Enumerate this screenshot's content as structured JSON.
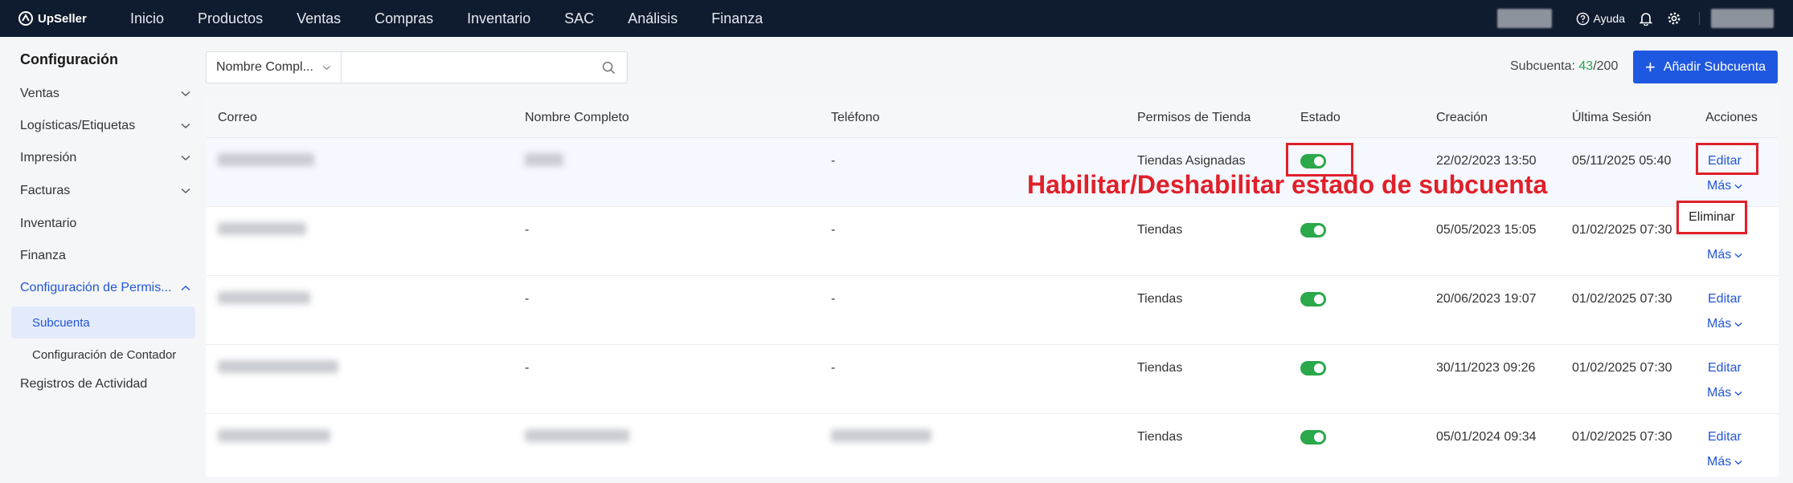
{
  "app": {
    "name": "UpSeller"
  },
  "nav": {
    "items": [
      "Inicio",
      "Productos",
      "Ventas",
      "Compras",
      "Inventario",
      "SAC",
      "Análisis",
      "Finanza"
    ],
    "help_label": "Ayuda"
  },
  "sidebar": {
    "title": "Configuración",
    "items": [
      {
        "label": "Ventas"
      },
      {
        "label": "Logísticas/Etiquetas"
      },
      {
        "label": "Impresión"
      },
      {
        "label": "Facturas"
      },
      {
        "label": "Inventario"
      },
      {
        "label": "Finanza"
      },
      {
        "label": "Configuración de Permis..."
      },
      {
        "label": "Registros de Actividad"
      }
    ],
    "subitems": [
      {
        "label": "Subcuenta"
      },
      {
        "label": "Configuración de Contador"
      }
    ]
  },
  "filter": {
    "select_label": "Nombre Compl...",
    "search_placeholder": ""
  },
  "subaccount": {
    "label": "Subcuenta: ",
    "used": "43",
    "total": "/200"
  },
  "add_button": {
    "label": "Añadir Subcuenta"
  },
  "table": {
    "headers": [
      "Correo",
      "Nombre Completo",
      "Teléfono",
      "Permisos de Tienda",
      "Estado",
      "Creación",
      "Última Sesión",
      "Acciones"
    ],
    "rows": [
      {
        "nombre": "",
        "telefono": "-",
        "permisos": "Tiendas Asignadas",
        "estado": true,
        "creacion": "22/02/2023 13:50",
        "ultima": "05/11/2025 05:40"
      },
      {
        "nombre": "-",
        "telefono": "-",
        "permisos": "Tiendas",
        "estado": true,
        "creacion": "05/05/2023 15:05",
        "ultima": "01/02/2025 07:30"
      },
      {
        "nombre": "-",
        "telefono": "-",
        "permisos": "Tiendas",
        "estado": true,
        "creacion": "20/06/2023 19:07",
        "ultima": "01/02/2025 07:30"
      },
      {
        "nombre": "-",
        "telefono": "-",
        "permisos": "Tiendas",
        "estado": true,
        "creacion": "30/11/2023 09:26",
        "ultima": "01/02/2025 07:30"
      },
      {
        "nombre": "",
        "telefono": "",
        "permisos": "Tiendas",
        "estado": true,
        "creacion": "05/01/2024 09:34",
        "ultima": "01/02/2025 07:30"
      }
    ],
    "edit_label": "Editar",
    "more_label": "Más"
  },
  "popup": {
    "delete_label": "Eliminar"
  },
  "annotation": {
    "text": "Habilitar/Deshabilitar estado de subcuenta"
  },
  "colors": {
    "nav_bg": "#0f1b2e",
    "primary": "#1f58e0",
    "toggle_on": "#2aa84a",
    "annotation": "#e0202a"
  }
}
